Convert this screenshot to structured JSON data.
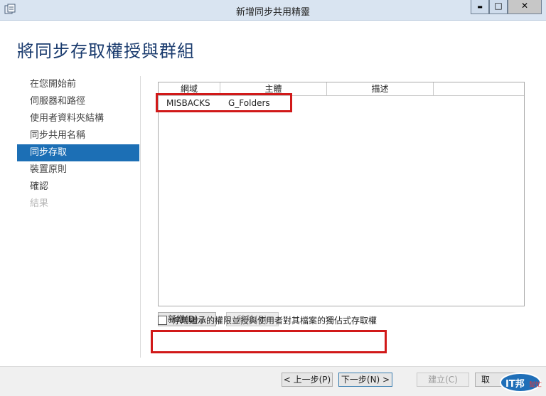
{
  "window": {
    "title": "新增同步共用精靈",
    "controls": {
      "minimize": "▬",
      "maximize": "□",
      "close": "✕"
    }
  },
  "page": {
    "title": "將同步存取權授與群組"
  },
  "nav": {
    "items": [
      {
        "label": "在您開始前",
        "state": "normal"
      },
      {
        "label": "伺服器和路徑",
        "state": "normal"
      },
      {
        "label": "使用者資料夾結構",
        "state": "normal"
      },
      {
        "label": "同步共用名稱",
        "state": "normal"
      },
      {
        "label": "同步存取",
        "state": "active"
      },
      {
        "label": "裝置原則",
        "state": "normal"
      },
      {
        "label": "確認",
        "state": "normal"
      },
      {
        "label": "結果",
        "state": "disabled"
      }
    ]
  },
  "grid": {
    "columns": [
      "網域",
      "主體",
      "描述"
    ],
    "rows": [
      {
        "domain": "MISBACKS",
        "principal": "G_Folders",
        "description": ""
      }
    ]
  },
  "buttons": {
    "add": "新增(D)...",
    "remove": "移除(R)",
    "prev": "< 上一步(P)",
    "next": "下一步(N) >",
    "create": "建立(C)",
    "cancel": "取"
  },
  "checkbox": {
    "label": "停用繼承的權限並授與使用者對其檔案的獨佔式存取權",
    "checked": false
  },
  "watermark": {
    "text": "IT邦",
    "subtext": "幫忙"
  },
  "colors": {
    "accent": "#1c6fb5",
    "title": "#1a3b6e",
    "highlight": "#d11919",
    "titlebar": "#d9e4f1"
  }
}
